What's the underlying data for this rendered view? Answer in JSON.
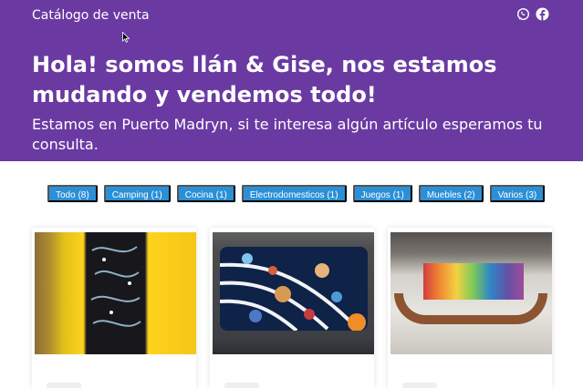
{
  "header": {
    "brand": "Catálogo de venta",
    "social": [
      {
        "icon": "whatsapp-icon"
      },
      {
        "icon": "facebook-icon"
      }
    ]
  },
  "hero": {
    "headline": "Hola! somos Ilán & Gise, nos estamos mudando y vendemos todo!",
    "subtitle": "Estamos en Puerto Madryn, si te interesa algún artículo esperamos tu consulta."
  },
  "filters": [
    {
      "label": "Todo (8)"
    },
    {
      "label": "Camping (1)"
    },
    {
      "label": "Cocina (1)"
    },
    {
      "label": "Electrodomesticos (1)"
    },
    {
      "label": "Juegos (1)"
    },
    {
      "label": "Muebles (2)"
    },
    {
      "label": "Varios (3)"
    }
  ],
  "colors": {
    "hero_bg": "#6a3aa2",
    "chip_bg": "#2c8fd6"
  },
  "cards": [
    {
      "image": "painted-black-cabinet"
    },
    {
      "image": "solar-system-board"
    },
    {
      "image": "rainbow-wooden-rocker"
    }
  ]
}
